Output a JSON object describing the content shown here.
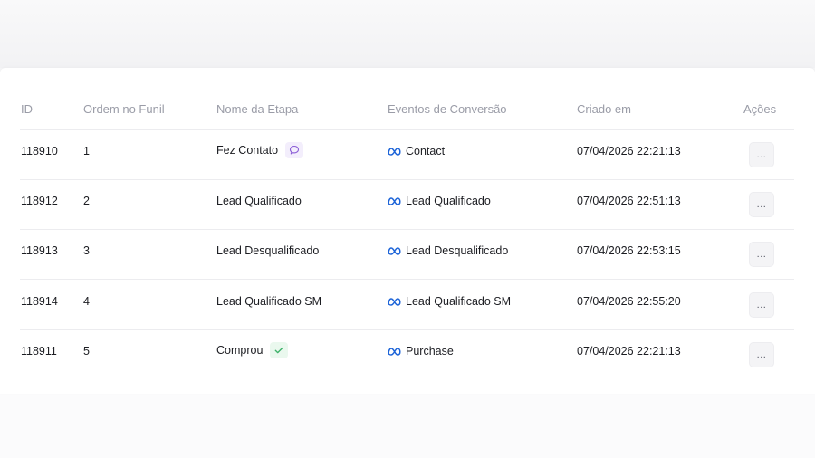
{
  "table": {
    "headers": {
      "id": "ID",
      "order": "Ordem no Funil",
      "stage": "Nome da Etapa",
      "events": "Eventos de Conversão",
      "created": "Criado em",
      "actions": "Ações"
    },
    "rows": [
      {
        "id": "118910",
        "order": "1",
        "stage": "Fez Contato",
        "stage_badge": "chat-bubble-icon",
        "event": "Contact",
        "event_icon": "meta-icon",
        "created": "07/04/2026 22:21:13",
        "actions_label": "..."
      },
      {
        "id": "118912",
        "order": "2",
        "stage": "Lead Qualificado",
        "stage_badge": "",
        "event": "Lead Qualificado",
        "event_icon": "meta-icon",
        "created": "07/04/2026 22:51:13",
        "actions_label": "..."
      },
      {
        "id": "118913",
        "order": "3",
        "stage": "Lead Desqualificado",
        "stage_badge": "",
        "event": "Lead Desqualificado",
        "event_icon": "meta-icon",
        "created": "07/04/2026 22:53:15",
        "actions_label": "..."
      },
      {
        "id": "118914",
        "order": "4",
        "stage": "Lead Qualificado SM",
        "stage_badge": "",
        "event": "Lead Qualificado SM",
        "event_icon": "meta-icon",
        "created": "07/04/2026 22:55:20",
        "actions_label": "..."
      },
      {
        "id": "118911",
        "order": "5",
        "stage": "Comprou",
        "stage_badge": "check-icon",
        "event": "Purchase",
        "event_icon": "meta-icon",
        "created": "07/04/2026 22:21:13",
        "actions_label": "..."
      }
    ]
  },
  "colors": {
    "header_text": "#9a9ca7",
    "body_text": "#1c1d22",
    "meta_blue": "#1d64d8",
    "chat_purple": "#8a5cd6",
    "check_green": "#3fb36b"
  }
}
